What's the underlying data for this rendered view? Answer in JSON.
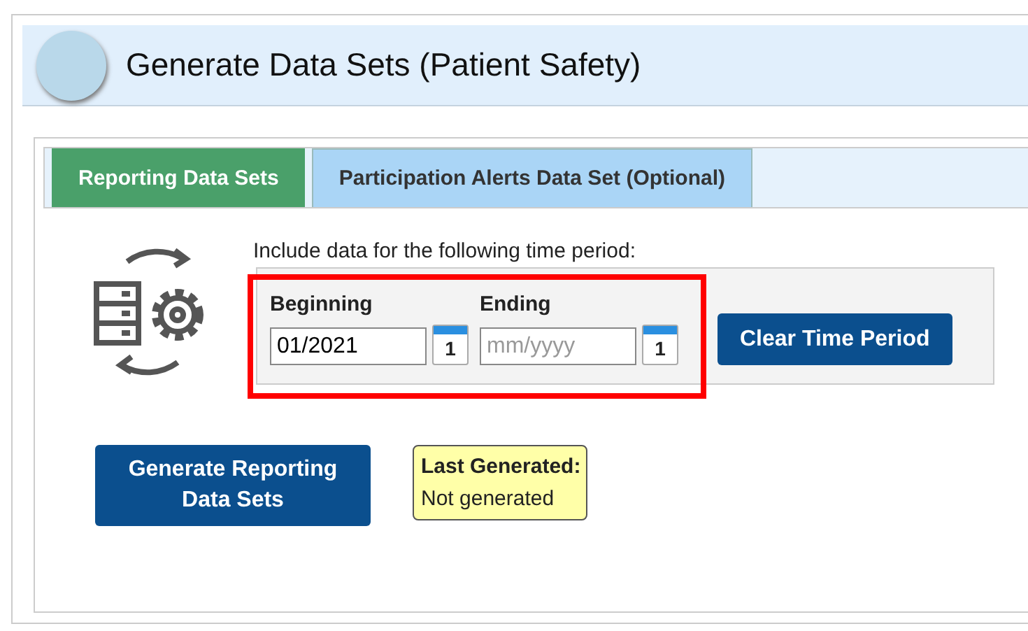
{
  "header": {
    "title": "Generate Data Sets (Patient Safety)"
  },
  "tabs": [
    {
      "label": "Reporting Data Sets",
      "selected": true
    },
    {
      "label": "Participation Alerts Data Set (Optional)",
      "selected": false
    }
  ],
  "time_period": {
    "prompt": "Include data for the following time period:",
    "highlighted": true,
    "fields": [
      {
        "label": "Beginning",
        "value": "01/2021",
        "calendar": "1"
      },
      {
        "label": "Ending",
        "placeholder": "mm/yyyy",
        "calendar": "1"
      }
    ],
    "clear_button": "Clear Time Period"
  },
  "generate_button": "Generate Reporting Data Sets",
  "last_generated": {
    "label": "Last Generated:",
    "value": "Not generated"
  }
}
